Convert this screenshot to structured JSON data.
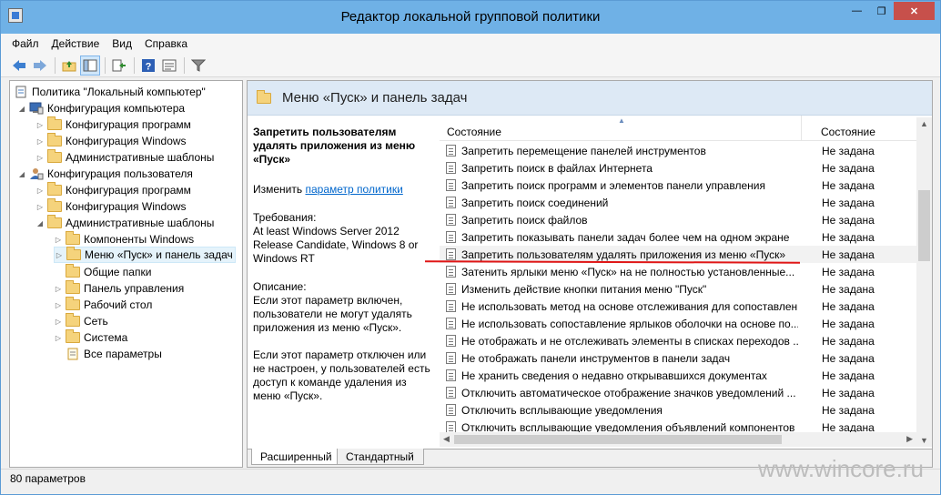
{
  "window": {
    "title": "Редактор локальной групповой политики"
  },
  "menu": [
    "Файл",
    "Действие",
    "Вид",
    "Справка"
  ],
  "tree": {
    "root": "Политика \"Локальный компьютер\"",
    "computer": "Конфигурация компьютера",
    "computer_children": [
      "Конфигурация программ",
      "Конфигурация Windows",
      "Административные шаблоны"
    ],
    "user": "Конфигурация пользователя",
    "user_children": [
      "Конфигурация программ",
      "Конфигурация Windows",
      "Административные шаблоны"
    ],
    "admin_children": [
      "Компоненты Windows",
      "Меню «Пуск» и панель задач",
      "Общие папки",
      "Панель управления",
      "Рабочий стол",
      "Сеть",
      "Система",
      "Все параметры"
    ]
  },
  "details": {
    "header": "Меню «Пуск» и панель задач",
    "policy_title": "Запретить пользователям удалять приложения из меню «Пуск»",
    "edit_prefix": "Изменить",
    "edit_link": "параметр политики",
    "req_label": "Требования:",
    "req_text": "At least Windows Server 2012 Release Candidate, Windows 8 or Windows RT",
    "desc_label": "Описание:",
    "desc_p1": "Если этот параметр включен, пользователи не могут удалять приложения из меню «Пуск».",
    "desc_p2": "Если этот параметр отключен или не настроен, у пользователей есть доступ к команде удаления из меню «Пуск»."
  },
  "list": {
    "col_name": "Состояние",
    "col_state": "Состояние",
    "rows": [
      {
        "name": "Запретить перемещение панелей инструментов",
        "state": "Не задана"
      },
      {
        "name": "Запретить поиск в файлах Интернета",
        "state": "Не задана"
      },
      {
        "name": "Запретить поиск программ и элементов панели управления",
        "state": "Не задана"
      },
      {
        "name": "Запретить поиск соединений",
        "state": "Не задана"
      },
      {
        "name": "Запретить поиск файлов",
        "state": "Не задана"
      },
      {
        "name": "Запретить показывать панели задач более чем на одном экране",
        "state": "Не задана"
      },
      {
        "name": "Запретить пользователям удалять приложения из меню «Пуск»",
        "state": "Не задана"
      },
      {
        "name": "Затенить ярлыки меню «Пуск» на не полностью установленные...",
        "state": "Не задана"
      },
      {
        "name": "Изменить действие кнопки питания меню \"Пуск\"",
        "state": "Не задана"
      },
      {
        "name": "Не использовать метод на основе отслеживания для сопоставлен...",
        "state": "Не задана"
      },
      {
        "name": "Не использовать сопоставление ярлыков оболочки на основе по...",
        "state": "Не задана"
      },
      {
        "name": "Не отображать и не отслеживать элементы в списках переходов ...",
        "state": "Не задана"
      },
      {
        "name": "Не отображать панели инструментов в панели задач",
        "state": "Не задана"
      },
      {
        "name": "Не хранить сведения о недавно открывавшихся документах",
        "state": "Не задана"
      },
      {
        "name": "Отключить автоматическое отображение значков уведомлений ...",
        "state": "Не задана"
      },
      {
        "name": "Отключить всплывающие уведомления",
        "state": "Не задана"
      },
      {
        "name": "Отключить всплывающие уведомления объявлений компонентов",
        "state": "Не задана"
      }
    ]
  },
  "tabs": [
    "Расширенный",
    "Стандартный"
  ],
  "status": "80 параметров",
  "watermark": "www.wincore.ru"
}
